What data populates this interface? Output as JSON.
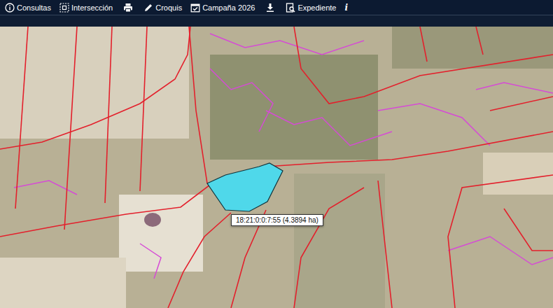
{
  "toolbar": {
    "items": [
      {
        "kind": "labeled",
        "label": "Consultas"
      },
      {
        "kind": "labeled",
        "label": "Intersección"
      },
      {
        "kind": "icon",
        "label": ""
      },
      {
        "kind": "labeled",
        "label": "Croquis"
      },
      {
        "kind": "labeled",
        "label": "Campaña 2026"
      },
      {
        "kind": "icon",
        "label": ""
      },
      {
        "kind": "labeled",
        "label": "Expediente"
      },
      {
        "kind": "glyph",
        "label": "i"
      }
    ]
  },
  "map": {
    "selected_parcel": {
      "label": "18:21:0:0:7:55 (4.3894 ha)"
    }
  }
}
